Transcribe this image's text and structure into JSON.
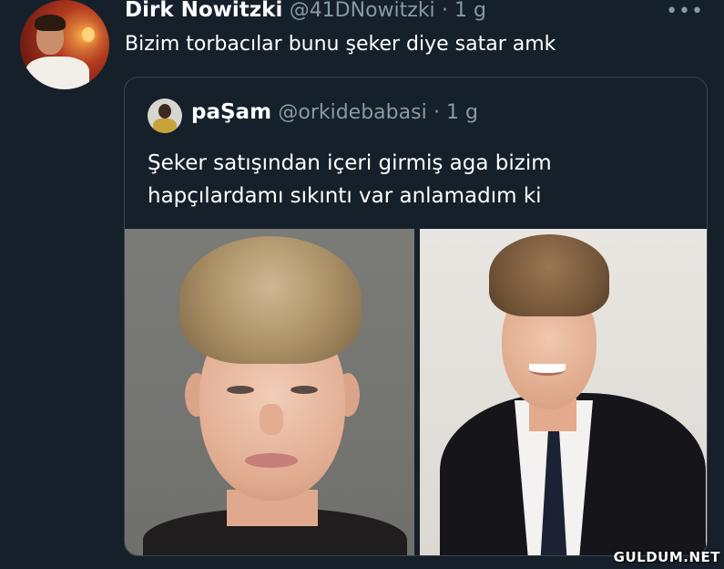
{
  "tweet": {
    "author_name": "Dirk Nowitzki",
    "author_handle": "@41DNowitzki",
    "time": "· 1 g",
    "text": "Bizim torbacılar bunu şeker diye satar amk",
    "more_icon": "more-horizontal-icon"
  },
  "quoted_tweet": {
    "author_name": "paŞam",
    "author_handle": "@orkidebabasi",
    "time": "· 1 g",
    "text": "Şeker satışından içeri girmiş aga bizim hapçılardamı sıkıntı var anlamadım ki"
  },
  "watermark": "GULDUM.NET",
  "colors": {
    "background": "#15202b",
    "secondary_text": "#8899a6",
    "border": "#38444d"
  }
}
